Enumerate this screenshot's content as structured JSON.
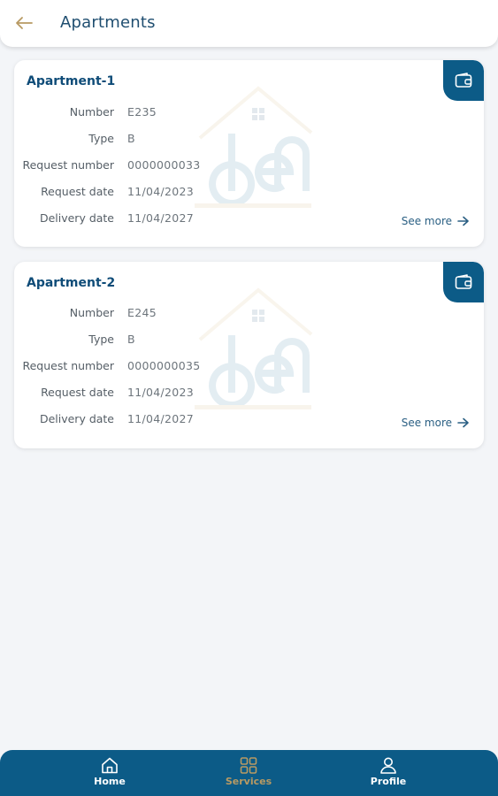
{
  "header": {
    "title": "Apartments",
    "back_icon": "arrow-left-icon",
    "accent_color": "#b89a63"
  },
  "apartments": [
    {
      "title": "Apartment-1",
      "fields": [
        {
          "label": "Number",
          "value": "E235"
        },
        {
          "label": "Type",
          "value": "B"
        },
        {
          "label": "Request number",
          "value": "0000000033"
        },
        {
          "label": "Request date",
          "value": "11/04/2023"
        },
        {
          "label": "Delivery date",
          "value": "11/04/2027"
        }
      ],
      "see_more": "See more",
      "watermark_text": "den"
    },
    {
      "title": "Apartment-2",
      "fields": [
        {
          "label": "Number",
          "value": "E245"
        },
        {
          "label": "Type",
          "value": "B"
        },
        {
          "label": "Request number",
          "value": "0000000035"
        },
        {
          "label": "Request date",
          "value": "11/04/2023"
        },
        {
          "label": "Delivery date",
          "value": "11/04/2027"
        }
      ],
      "see_more": "See more",
      "watermark_text": "den"
    }
  ],
  "bottom_nav": {
    "items": [
      {
        "label": "Home",
        "icon": "home-icon",
        "active": false
      },
      {
        "label": "Services",
        "icon": "grid-icon",
        "active": true
      },
      {
        "label": "Profile",
        "icon": "user-icon",
        "active": false
      }
    ],
    "background": "#0c5b87"
  }
}
